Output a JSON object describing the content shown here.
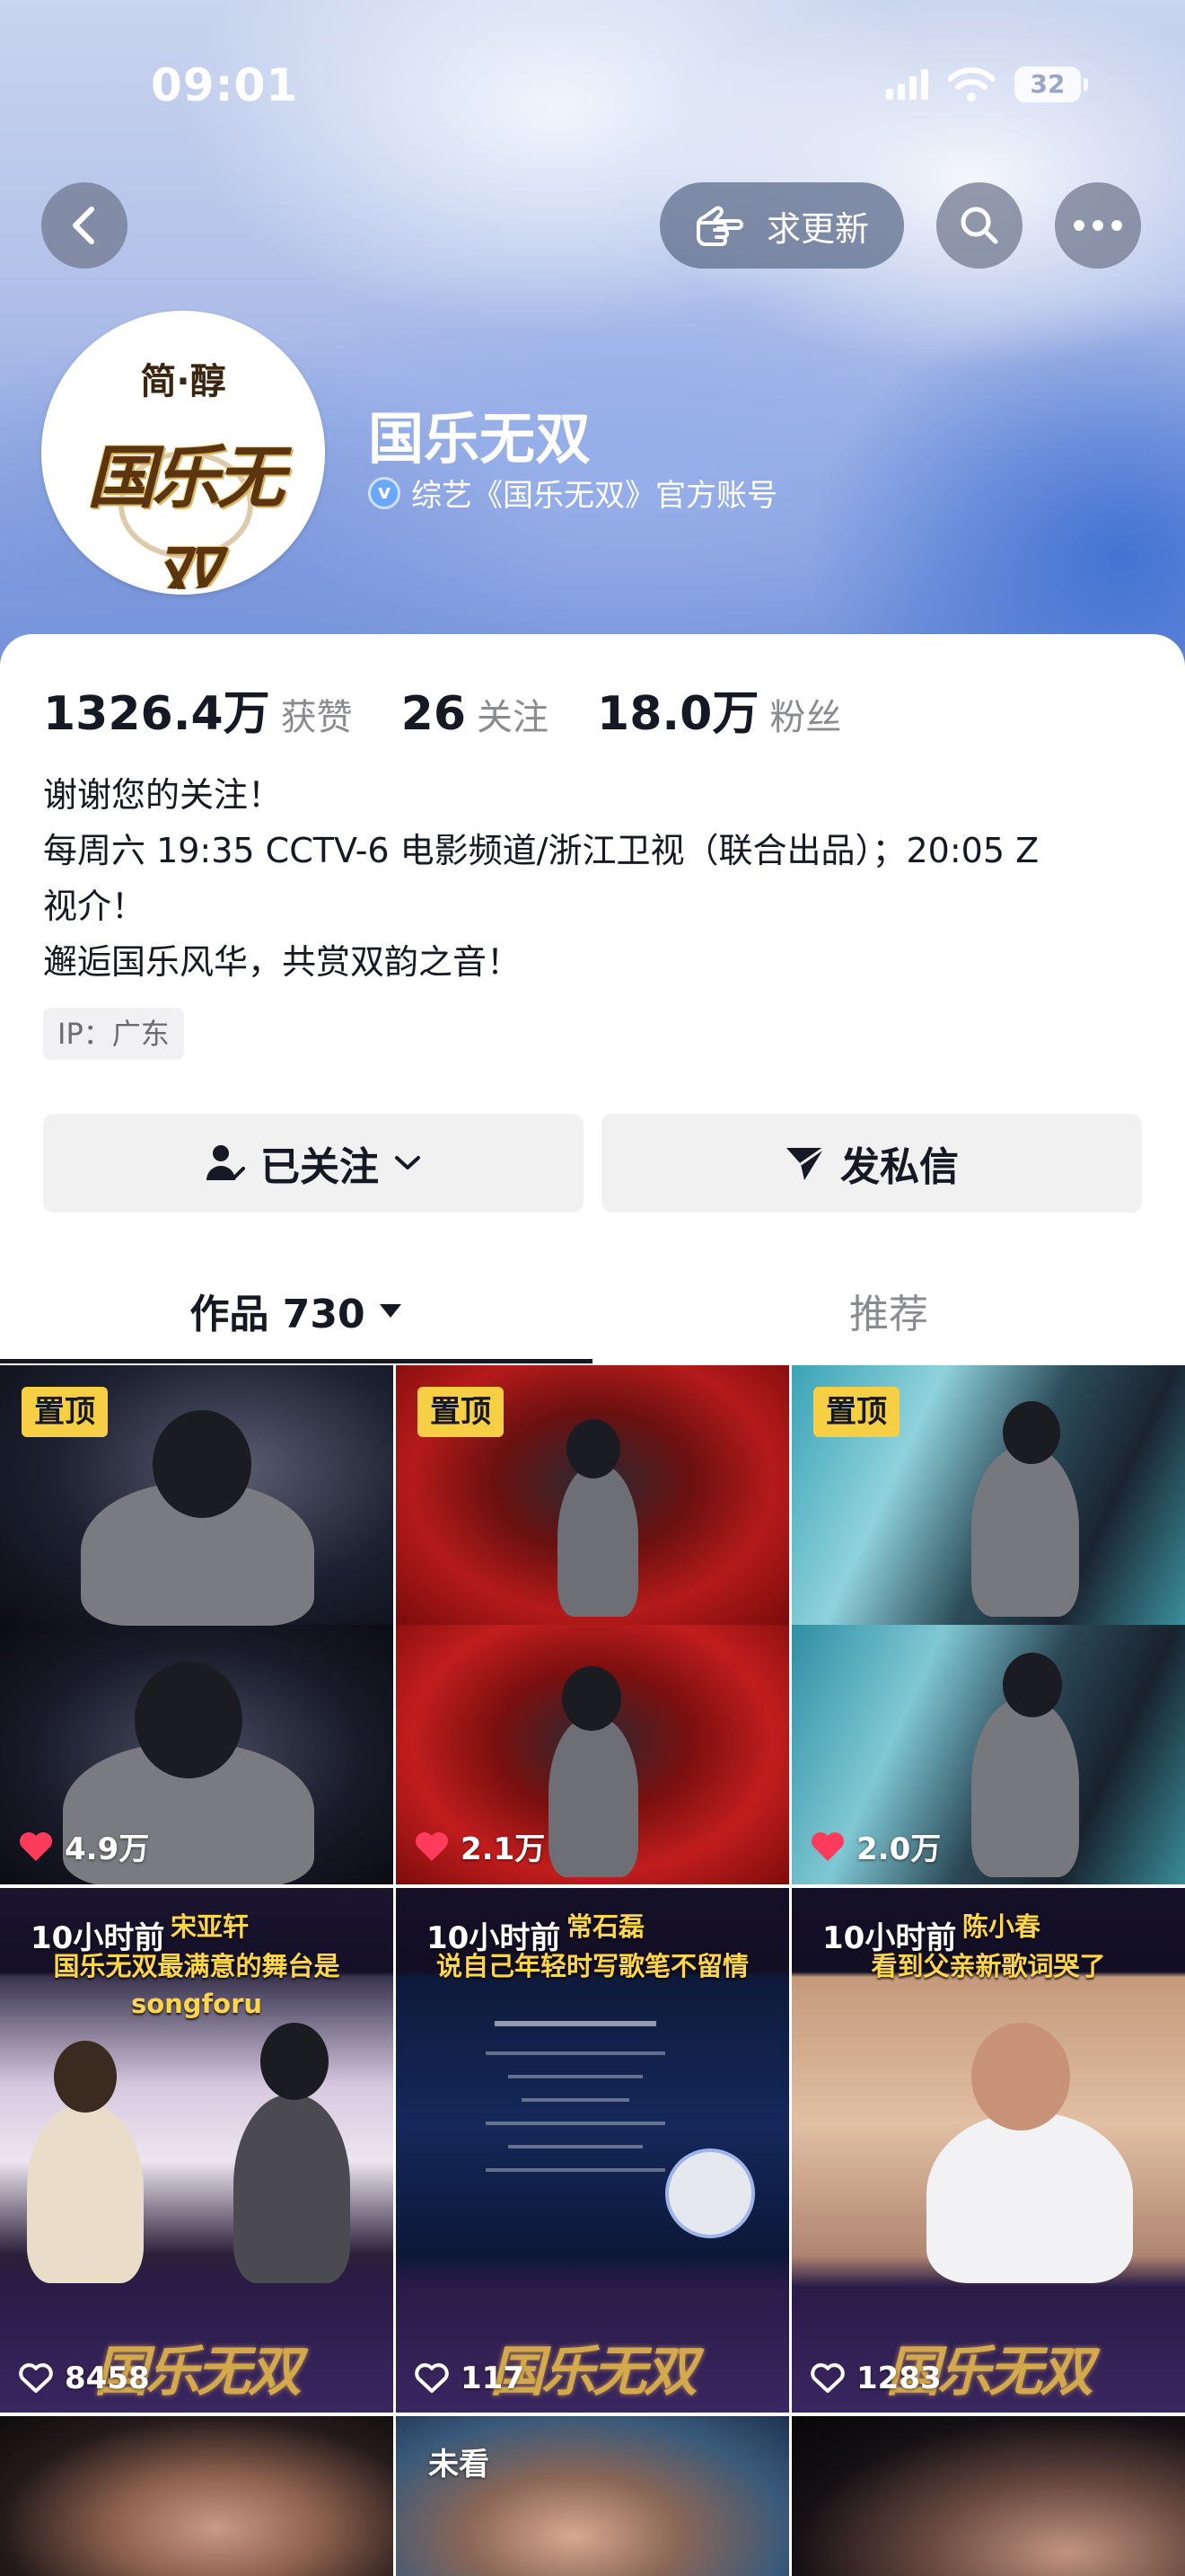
{
  "status_bar": {
    "time": "09:01",
    "battery": "32"
  },
  "header": {
    "update_button_label": "求更新"
  },
  "profile": {
    "name": "国乐无双",
    "verified_text": "综艺《国乐无双》官方账号",
    "avatar_logo_top": "简·醇",
    "avatar_logo_main": "国乐无双"
  },
  "stats": [
    {
      "value": "1326.4万",
      "label": "获赞"
    },
    {
      "value": "26",
      "label": "关注"
    },
    {
      "value": "18.0万",
      "label": "粉丝"
    }
  ],
  "bio": {
    "line1": "谢谢您的关注！",
    "line2": "每周六 19:35 CCTV-6 电影频道/浙江卫视（联合出品）；20:05 Z",
    "line3": "视介！",
    "line4": "邂逅国乐风华，共赏双韵之音！"
  },
  "ip_location": "IP：广东",
  "actions": {
    "follow_label": "已关注",
    "message_label": "发私信"
  },
  "tabs": {
    "works_label": "作品 730",
    "recommend_label": "推荐"
  },
  "videos": [
    {
      "pinned_label": "置顶",
      "likes": "4.9万"
    },
    {
      "pinned_label": "置顶",
      "likes": "2.1万"
    },
    {
      "pinned_label": "置顶",
      "likes": "2.0万"
    },
    {
      "time_label": "10小时前",
      "caption_name": "宋亚轩",
      "caption_text": "国乐无双最满意的舞台是songforu",
      "likes": "8458"
    },
    {
      "time_label": "10小时前",
      "caption_name": "常石磊",
      "caption_text": "说自己年轻时写歌笔不留情",
      "likes": "117"
    },
    {
      "time_label": "10小时前",
      "caption_name": "陈小春",
      "caption_text": "看到父亲新歌词哭了",
      "likes": "1283"
    },
    {},
    {
      "unwatched_label": "未看"
    },
    {}
  ],
  "colors": {
    "pin_badge": "#f7cf45",
    "heart_red": "#ff3b5c",
    "caption_gold": "#ffd54a",
    "verified_blue": "#6aa7ff"
  }
}
